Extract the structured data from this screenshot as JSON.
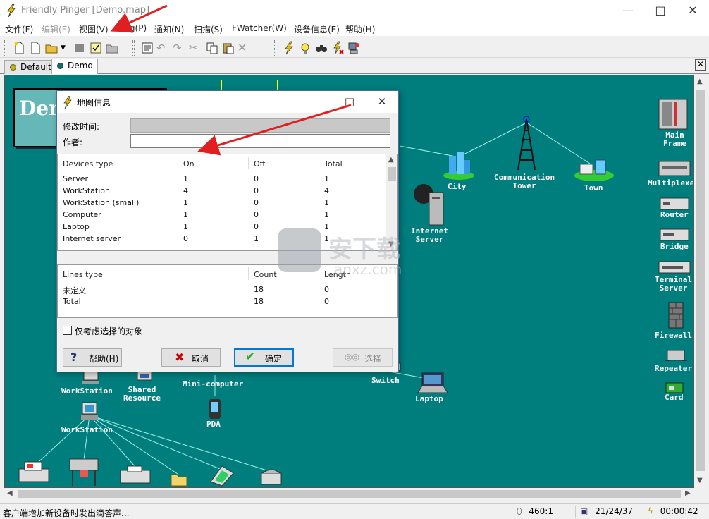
{
  "window": {
    "title": "Friendly Pinger [Demo.map]"
  },
  "menu": [
    {
      "label": "文件(F)",
      "enabled": true
    },
    {
      "label": "编辑(E)",
      "enabled": false
    },
    {
      "label": "视图(V)",
      "enabled": true
    },
    {
      "label": "Ping(P)",
      "enabled": true
    },
    {
      "label": "通知(N)",
      "enabled": true
    },
    {
      "label": "扫描(S)",
      "enabled": true
    },
    {
      "label": "FWatcher(W)",
      "enabled": true
    },
    {
      "label": "设备信息(E)",
      "enabled": true
    },
    {
      "label": "帮助(H)",
      "enabled": true
    }
  ],
  "tabs": [
    {
      "label": "Default",
      "active": false,
      "color": "#c8b400"
    },
    {
      "label": "Demo",
      "active": true,
      "color": "#0b6f6f"
    }
  ],
  "map": {
    "background": "#007d7d",
    "banner_text": "Dem",
    "devices": [
      {
        "label": "City"
      },
      {
        "label": "Communication\nTower"
      },
      {
        "label": "Town"
      },
      {
        "label": "Internet\nServer"
      },
      {
        "label": "Main\nFrame"
      },
      {
        "label": "Multiplexer"
      },
      {
        "label": "Router"
      },
      {
        "label": "Bridge"
      },
      {
        "label": "Terminal\nServer"
      },
      {
        "label": "Firewall"
      },
      {
        "label": "Repeater"
      },
      {
        "label": "Card"
      },
      {
        "label": "WorkStation"
      },
      {
        "label": "Shared\nResource"
      },
      {
        "label": "Mini-computer"
      },
      {
        "label": "Switch"
      },
      {
        "label": "Laptop"
      },
      {
        "label": "PDA"
      },
      {
        "label": "WorkStation"
      }
    ]
  },
  "dialog": {
    "title": "地图信息",
    "modified_label": "修改时间:",
    "modified_value": "",
    "author_label": "作者:",
    "author_value": "",
    "devices_table": {
      "headers": [
        "Devices type",
        "On",
        "Off",
        "Total"
      ],
      "rows": [
        [
          "Server",
          "1",
          "0",
          "1"
        ],
        [
          "WorkStation",
          "4",
          "0",
          "4"
        ],
        [
          "WorkStation (small)",
          "1",
          "0",
          "1"
        ],
        [
          "Computer",
          "1",
          "0",
          "1"
        ],
        [
          "Laptop",
          "1",
          "0",
          "1"
        ],
        [
          "Internet server",
          "0",
          "1",
          "1"
        ]
      ]
    },
    "lines_table": {
      "headers": [
        "Lines type",
        "Count",
        "Length"
      ],
      "rows": [
        [
          "未定义",
          "18",
          "0"
        ],
        [
          "Total",
          "18",
          "0"
        ]
      ]
    },
    "checkbox_label": "仅考虑选择的对象",
    "buttons": {
      "help": "帮助(H)",
      "cancel": "取消",
      "ok": "确定",
      "select": "选择"
    }
  },
  "statusbar": {
    "message": "客户端增加新设备时发出滴答声...",
    "coords": "460:1",
    "counts": "21/24/37",
    "time": "00:00:42"
  },
  "watermark": {
    "text": "安下载",
    "subtext": "anxz.com"
  }
}
